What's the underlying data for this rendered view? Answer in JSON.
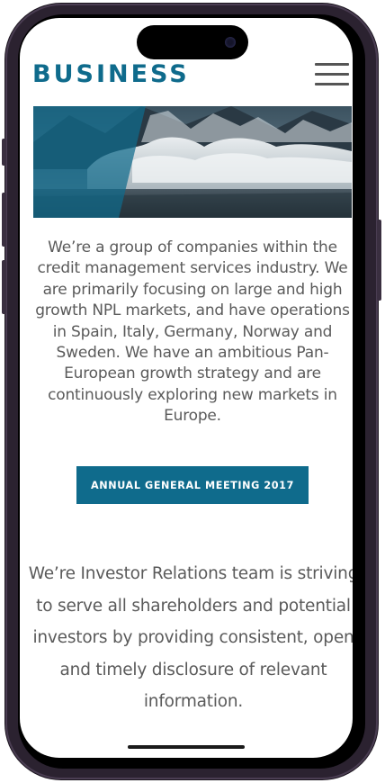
{
  "header": {
    "logo": "BUSINESS"
  },
  "colors": {
    "brand": "#0f6b8c",
    "text": "#5a5a5a",
    "button_text": "#ffffff"
  },
  "main": {
    "intro": "We’re a group of companies within the credit management services industry. We are primarily focusing on large and high growth NPL markets, and have operations in Spain, Italy, Germany, Norway and Sweden. We have an ambitious Pan-European growth strategy and are continuously exploring new markets in Europe.",
    "cta_label": "ANNUAL GENERAL MEETING 2017",
    "ir_text": "We’re Investor Relations team is striving to serve all shareholders and potential investors by providing consistent, open and timely disclosure of relevant information."
  },
  "icons": {
    "menu": "hamburger-menu-icon"
  }
}
